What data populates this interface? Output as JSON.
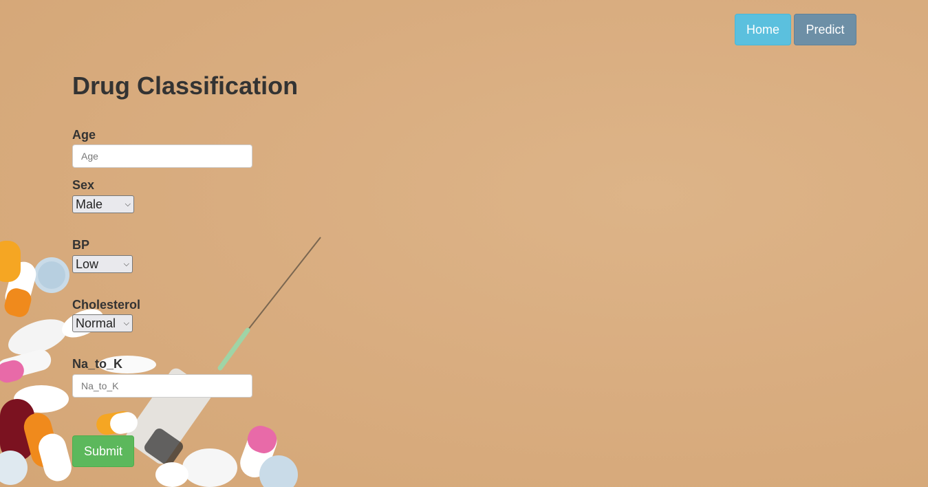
{
  "nav": {
    "home_label": "Home",
    "predict_label": "Predict"
  },
  "page": {
    "title": "Drug Classification"
  },
  "form": {
    "age": {
      "label": "Age",
      "placeholder": "Age",
      "value": ""
    },
    "sex": {
      "label": "Sex",
      "selected": "Male"
    },
    "bp": {
      "label": "BP",
      "selected": "Low"
    },
    "cholesterol": {
      "label": "Cholesterol",
      "selected": "Normal"
    },
    "na_to_k": {
      "label": "Na_to_K",
      "placeholder": "Na_to_K",
      "value": ""
    },
    "submit_label": "Submit"
  },
  "colors": {
    "background": "#d9ad80",
    "home_button": "#5bc0de",
    "predict_button": "#6d8fa6",
    "submit_button": "#5cb85c",
    "text": "#333333"
  },
  "icons": {
    "select_arrow": "chevron-down-icon"
  }
}
